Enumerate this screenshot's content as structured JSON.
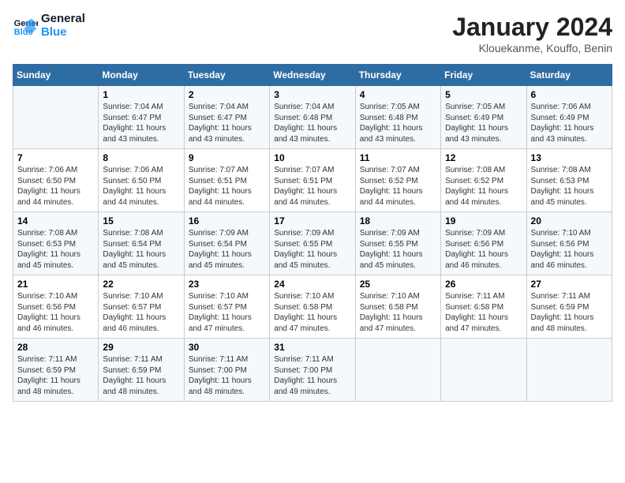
{
  "header": {
    "logo_line1": "General",
    "logo_line2": "Blue",
    "title": "January 2024",
    "subtitle": "Klouekanme, Kouffo, Benin"
  },
  "days_of_week": [
    "Sunday",
    "Monday",
    "Tuesday",
    "Wednesday",
    "Thursday",
    "Friday",
    "Saturday"
  ],
  "weeks": [
    [
      {
        "num": "",
        "info": ""
      },
      {
        "num": "1",
        "info": "Sunrise: 7:04 AM\nSunset: 6:47 PM\nDaylight: 11 hours\nand 43 minutes."
      },
      {
        "num": "2",
        "info": "Sunrise: 7:04 AM\nSunset: 6:47 PM\nDaylight: 11 hours\nand 43 minutes."
      },
      {
        "num": "3",
        "info": "Sunrise: 7:04 AM\nSunset: 6:48 PM\nDaylight: 11 hours\nand 43 minutes."
      },
      {
        "num": "4",
        "info": "Sunrise: 7:05 AM\nSunset: 6:48 PM\nDaylight: 11 hours\nand 43 minutes."
      },
      {
        "num": "5",
        "info": "Sunrise: 7:05 AM\nSunset: 6:49 PM\nDaylight: 11 hours\nand 43 minutes."
      },
      {
        "num": "6",
        "info": "Sunrise: 7:06 AM\nSunset: 6:49 PM\nDaylight: 11 hours\nand 43 minutes."
      }
    ],
    [
      {
        "num": "7",
        "info": "Sunrise: 7:06 AM\nSunset: 6:50 PM\nDaylight: 11 hours\nand 44 minutes."
      },
      {
        "num": "8",
        "info": "Sunrise: 7:06 AM\nSunset: 6:50 PM\nDaylight: 11 hours\nand 44 minutes."
      },
      {
        "num": "9",
        "info": "Sunrise: 7:07 AM\nSunset: 6:51 PM\nDaylight: 11 hours\nand 44 minutes."
      },
      {
        "num": "10",
        "info": "Sunrise: 7:07 AM\nSunset: 6:51 PM\nDaylight: 11 hours\nand 44 minutes."
      },
      {
        "num": "11",
        "info": "Sunrise: 7:07 AM\nSunset: 6:52 PM\nDaylight: 11 hours\nand 44 minutes."
      },
      {
        "num": "12",
        "info": "Sunrise: 7:08 AM\nSunset: 6:52 PM\nDaylight: 11 hours\nand 44 minutes."
      },
      {
        "num": "13",
        "info": "Sunrise: 7:08 AM\nSunset: 6:53 PM\nDaylight: 11 hours\nand 45 minutes."
      }
    ],
    [
      {
        "num": "14",
        "info": "Sunrise: 7:08 AM\nSunset: 6:53 PM\nDaylight: 11 hours\nand 45 minutes."
      },
      {
        "num": "15",
        "info": "Sunrise: 7:08 AM\nSunset: 6:54 PM\nDaylight: 11 hours\nand 45 minutes."
      },
      {
        "num": "16",
        "info": "Sunrise: 7:09 AM\nSunset: 6:54 PM\nDaylight: 11 hours\nand 45 minutes."
      },
      {
        "num": "17",
        "info": "Sunrise: 7:09 AM\nSunset: 6:55 PM\nDaylight: 11 hours\nand 45 minutes."
      },
      {
        "num": "18",
        "info": "Sunrise: 7:09 AM\nSunset: 6:55 PM\nDaylight: 11 hours\nand 45 minutes."
      },
      {
        "num": "19",
        "info": "Sunrise: 7:09 AM\nSunset: 6:56 PM\nDaylight: 11 hours\nand 46 minutes."
      },
      {
        "num": "20",
        "info": "Sunrise: 7:10 AM\nSunset: 6:56 PM\nDaylight: 11 hours\nand 46 minutes."
      }
    ],
    [
      {
        "num": "21",
        "info": "Sunrise: 7:10 AM\nSunset: 6:56 PM\nDaylight: 11 hours\nand 46 minutes."
      },
      {
        "num": "22",
        "info": "Sunrise: 7:10 AM\nSunset: 6:57 PM\nDaylight: 11 hours\nand 46 minutes."
      },
      {
        "num": "23",
        "info": "Sunrise: 7:10 AM\nSunset: 6:57 PM\nDaylight: 11 hours\nand 47 minutes."
      },
      {
        "num": "24",
        "info": "Sunrise: 7:10 AM\nSunset: 6:58 PM\nDaylight: 11 hours\nand 47 minutes."
      },
      {
        "num": "25",
        "info": "Sunrise: 7:10 AM\nSunset: 6:58 PM\nDaylight: 11 hours\nand 47 minutes."
      },
      {
        "num": "26",
        "info": "Sunrise: 7:11 AM\nSunset: 6:58 PM\nDaylight: 11 hours\nand 47 minutes."
      },
      {
        "num": "27",
        "info": "Sunrise: 7:11 AM\nSunset: 6:59 PM\nDaylight: 11 hours\nand 48 minutes."
      }
    ],
    [
      {
        "num": "28",
        "info": "Sunrise: 7:11 AM\nSunset: 6:59 PM\nDaylight: 11 hours\nand 48 minutes."
      },
      {
        "num": "29",
        "info": "Sunrise: 7:11 AM\nSunset: 6:59 PM\nDaylight: 11 hours\nand 48 minutes."
      },
      {
        "num": "30",
        "info": "Sunrise: 7:11 AM\nSunset: 7:00 PM\nDaylight: 11 hours\nand 48 minutes."
      },
      {
        "num": "31",
        "info": "Sunrise: 7:11 AM\nSunset: 7:00 PM\nDaylight: 11 hours\nand 49 minutes."
      },
      {
        "num": "",
        "info": ""
      },
      {
        "num": "",
        "info": ""
      },
      {
        "num": "",
        "info": ""
      }
    ]
  ]
}
